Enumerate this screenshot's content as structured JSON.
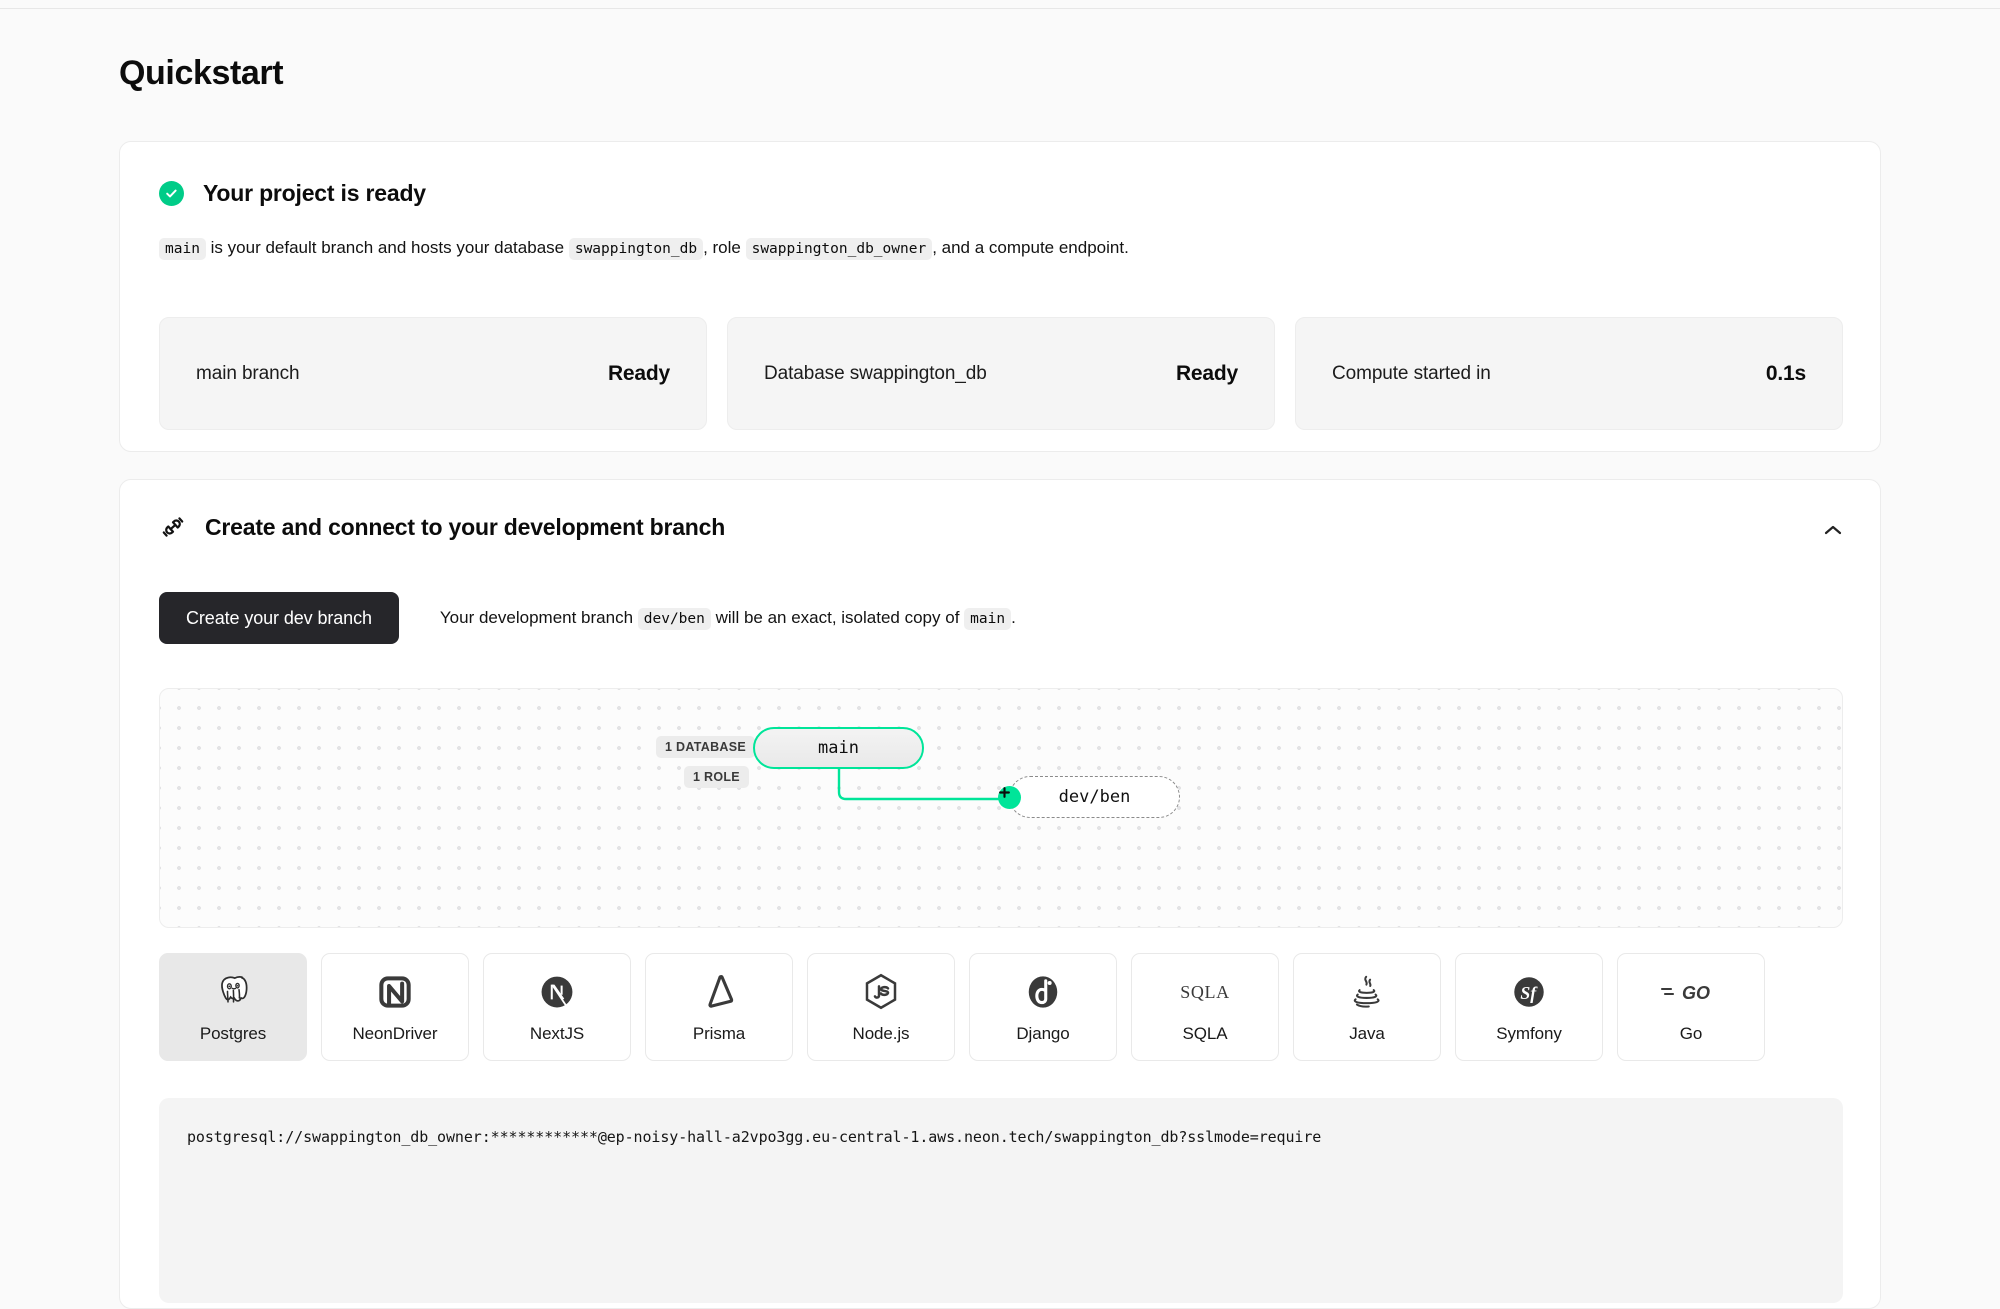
{
  "page": {
    "title": "Quickstart"
  },
  "ready_panel": {
    "icon": "check-circle-icon",
    "heading": "Your project is ready",
    "description": {
      "branch_chip": "main",
      "text_1": "is your default branch and hosts your database",
      "db_chip": "swappington_db",
      "text_2": ", role",
      "role_chip": "swappington_db_owner",
      "text_3": ", and a compute endpoint."
    },
    "stats": [
      {
        "label": "main branch",
        "value": "Ready"
      },
      {
        "label": "Database swappington_db",
        "value": "Ready"
      },
      {
        "label": "Compute started in",
        "value": "0.1s"
      }
    ]
  },
  "dev_panel": {
    "icon": "plug-connector-icon",
    "heading": "Create and connect to your development branch",
    "collapse_icon": "chevron-up-icon",
    "create_button": "Create your dev branch",
    "description": {
      "text_1": "Your development branch",
      "dev_chip": "dev/ben",
      "text_2": "will be an exact, isolated copy of",
      "main_chip": "main",
      "text_3": "."
    },
    "diagram": {
      "tag_database": "1 DATABASE",
      "tag_role": "1 ROLE",
      "node_main": "main",
      "node_dev": "dev/ben",
      "add_button_icon": "plus-icon",
      "accent_color": "#00e599"
    },
    "frameworks": [
      {
        "id": "postgres",
        "label": "Postgres",
        "icon": "postgres-elephant-icon",
        "active": true
      },
      {
        "id": "neondriver",
        "label": "NeonDriver",
        "icon": "neon-driver-icon",
        "active": false
      },
      {
        "id": "nextjs",
        "label": "NextJS",
        "icon": "nextjs-icon",
        "active": false
      },
      {
        "id": "prisma",
        "label": "Prisma",
        "icon": "prisma-icon",
        "active": false
      },
      {
        "id": "nodejs",
        "label": "Node.js",
        "icon": "nodejs-hexagon-icon",
        "active": false
      },
      {
        "id": "django",
        "label": "Django",
        "icon": "django-icon",
        "active": false
      },
      {
        "id": "sqla",
        "label": "SQLA",
        "icon": "sqlalchemy-icon",
        "active": false
      },
      {
        "id": "java",
        "label": "Java",
        "icon": "java-coffee-cup-icon",
        "active": false
      },
      {
        "id": "symfony",
        "label": "Symfony",
        "icon": "symfony-icon",
        "active": false
      },
      {
        "id": "go",
        "label": "Go",
        "icon": "golang-gopher-icon",
        "active": false
      }
    ],
    "connection_string": "postgresql://swappington_db_owner:************@ep-noisy-hall-a2vpo3gg.eu-central-1.aws.neon.tech/swappington_db?sslmode=require"
  }
}
